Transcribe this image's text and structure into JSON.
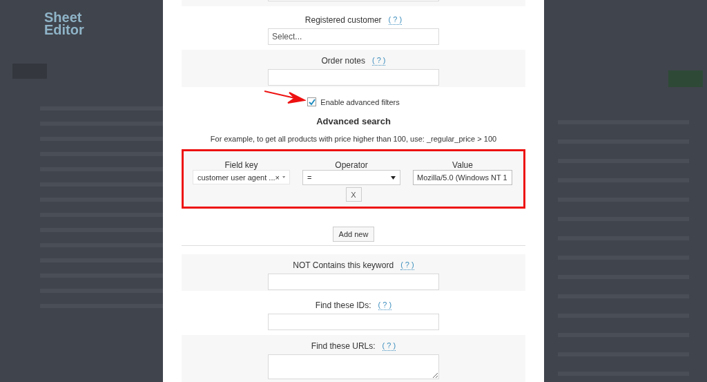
{
  "logo": {
    "line1": "Sheet",
    "line2": "Editor"
  },
  "sections_before": [
    {
      "kind": "select",
      "label": "Registered customer",
      "help": "( ? )",
      "placeholder": "Select..."
    },
    {
      "kind": "input",
      "label": "Order notes",
      "help": "( ? )"
    }
  ],
  "advanced_toggle": {
    "label": "Enable advanced filters",
    "checked": true
  },
  "advanced": {
    "heading": "Advanced search",
    "example": "For example, to get all products with price higher than 100, use: _regular_price > 100",
    "highlighted": true,
    "rule": {
      "field_key": {
        "label": "Field key",
        "value": "customer user agent ...",
        "clear": "×"
      },
      "operator": {
        "label": "Operator",
        "value": "="
      },
      "value": {
        "label": "Value",
        "value": "Mozilla/5.0 (Windows NT 1"
      },
      "remove": "X"
    },
    "add_button": "Add new"
  },
  "sections_after": [
    {
      "kind": "input",
      "label": "NOT Contains this keyword",
      "help": "( ? )"
    },
    {
      "kind": "input",
      "label": "Find these IDs:",
      "help": "( ? )"
    },
    {
      "kind": "textarea",
      "label": "Find these URLs:",
      "help": "( ? )"
    }
  ]
}
